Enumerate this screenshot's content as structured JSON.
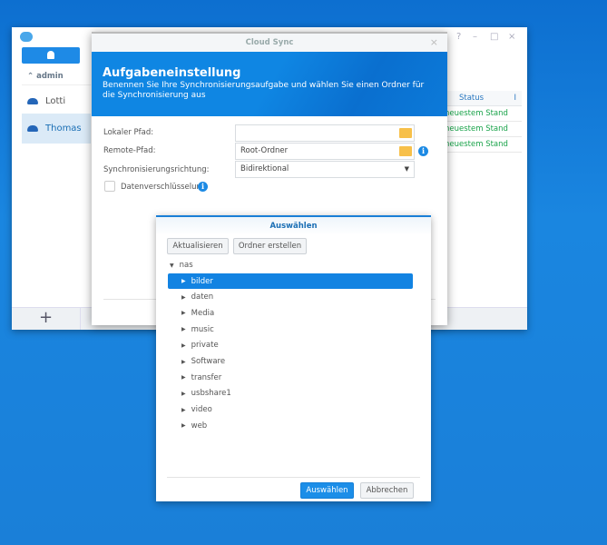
{
  "main_window": {
    "sidebar": {
      "group": "admin",
      "items": [
        {
          "label": "Lotti"
        },
        {
          "label": "Thomas",
          "selected": true
        }
      ]
    },
    "add_label": "+",
    "controls": [
      "?",
      "–",
      "□",
      "×"
    ],
    "table": {
      "header": "Status",
      "header_extra": "I",
      "rows": [
        "neuestem Stand",
        "neuestem Stand",
        "neuestem Stand"
      ]
    }
  },
  "dialog": {
    "title": "Cloud Sync",
    "heading": "Aufgabeneinstellung",
    "description": "Benennen Sie Ihre Synchronisierungsaufgabe und wählen Sie einen Ordner für die Synchronisierung aus",
    "local_path_label": "Lokaler Pfad:",
    "local_path_value": "",
    "remote_path_label": "Remote-Pfad:",
    "remote_path_value": "Root-Ordner",
    "direction_label": "Synchronisierungsrichtung:",
    "direction_value": "Bidirektional",
    "encryption_label": "Datenverschlüsselung",
    "encryption_checked": false,
    "info": "i"
  },
  "chooser": {
    "title": "Auswählen",
    "refresh": "Aktualisieren",
    "create_folder": "Ordner erstellen",
    "root": "nas",
    "folders": [
      "bilder",
      "daten",
      "Media",
      "music",
      "private",
      "Software",
      "transfer",
      "usbshare1",
      "video",
      "web"
    ],
    "selected": "bilder",
    "ok": "Auswählen",
    "cancel": "Abbrechen"
  },
  "colors": {
    "accent": "#1283e2",
    "status_ok": "#1aa34a"
  }
}
